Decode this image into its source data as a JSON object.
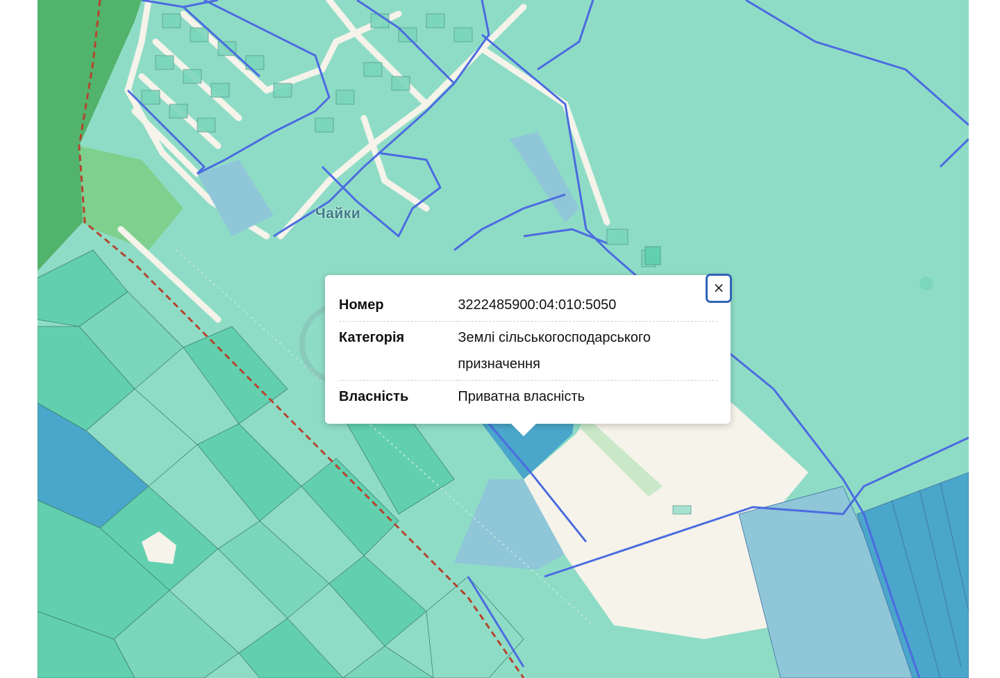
{
  "map": {
    "place_label": "Чайки",
    "colors": {
      "background": "#8fdcc6",
      "parcel_green": "#62d0ae",
      "parcel_light": "#a6e2d2",
      "forest": "#52b36c",
      "road": "#f5f3ea",
      "boundary_blue": "#4b6be0",
      "selected_parcel": "#4aa6ca",
      "admin_border": "#b5442e"
    }
  },
  "popup": {
    "rows": [
      {
        "label": "Номер",
        "value": "3222485900:04:010:5050"
      },
      {
        "label": "Категорія",
        "value": "Землі сільськогосподарського призначення"
      },
      {
        "label": "Власність",
        "value": "Приватна власність"
      }
    ],
    "close_label": "×"
  }
}
